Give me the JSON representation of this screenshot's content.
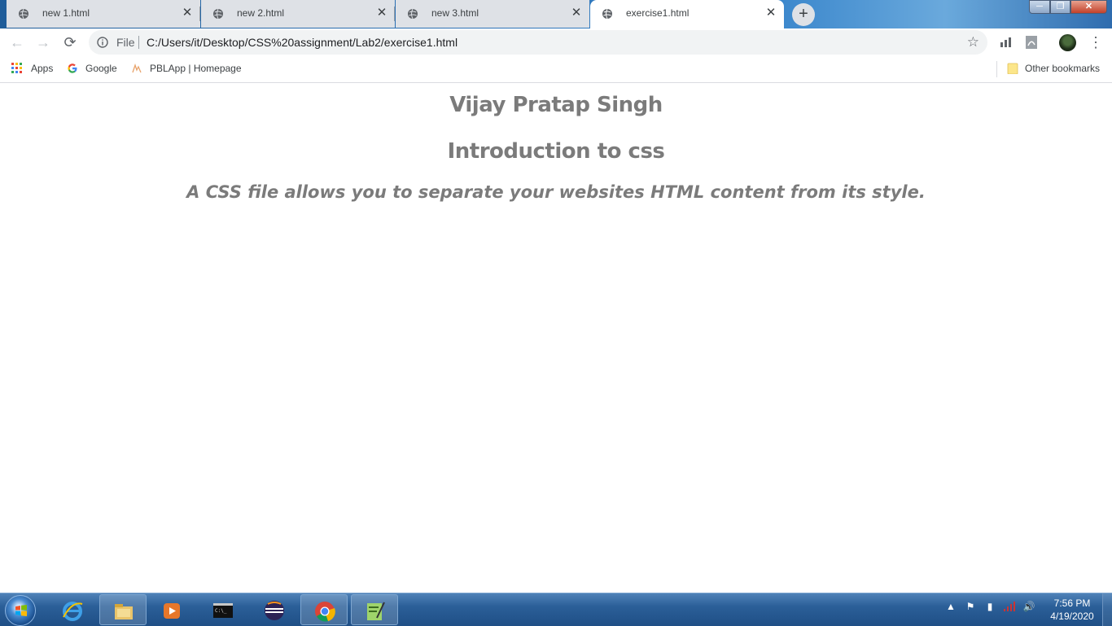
{
  "browser": {
    "tabs": [
      {
        "title": "new 1.html",
        "active": false
      },
      {
        "title": "new 2.html",
        "active": false
      },
      {
        "title": "new 3.html",
        "active": false
      },
      {
        "title": "exercise1.html",
        "active": true
      }
    ],
    "new_tab_icon": "plus-icon",
    "window_controls": {
      "minimize": "─",
      "maximize": "❐",
      "close": "✕"
    },
    "toolbar": {
      "back": "←",
      "forward": "→",
      "reload": "⟳",
      "scheme_label": "File",
      "url": "C:/Users/it/Desktop/CSS%20assignment/Lab2/exercise1.html",
      "star": "☆",
      "menu": "⋮"
    },
    "bookmarks": [
      {
        "label": "Apps",
        "icon": "apps-grid-icon"
      },
      {
        "label": "Google",
        "icon": "google-icon"
      },
      {
        "label": "PBLApp | Homepage",
        "icon": "pblapp-icon"
      }
    ],
    "other_bookmarks": "Other bookmarks"
  },
  "page": {
    "heading1": "Vijay Pratap Singh",
    "heading2": "Introduction to css",
    "paragraph": "A CSS file allows you to separate your websites HTML content from its style.",
    "text_color": "#7b7b7b"
  },
  "taskbar": {
    "apps": [
      "internet-explorer-icon",
      "file-explorer-icon",
      "media-player-icon",
      "command-prompt-icon",
      "eclipse-icon",
      "chrome-icon",
      "notepad-plus-plus-icon"
    ],
    "clock": {
      "time": "7:56 PM",
      "date": "4/19/2020"
    },
    "tray_icons": [
      "show-hidden-icon",
      "action-center-flag-icon",
      "battery-icon",
      "network-icon",
      "volume-icon"
    ]
  },
  "colors": {
    "tab_inactive": "#dee1e6",
    "omnibox": "#f1f3f4",
    "taskbar": "#2b5f98"
  }
}
